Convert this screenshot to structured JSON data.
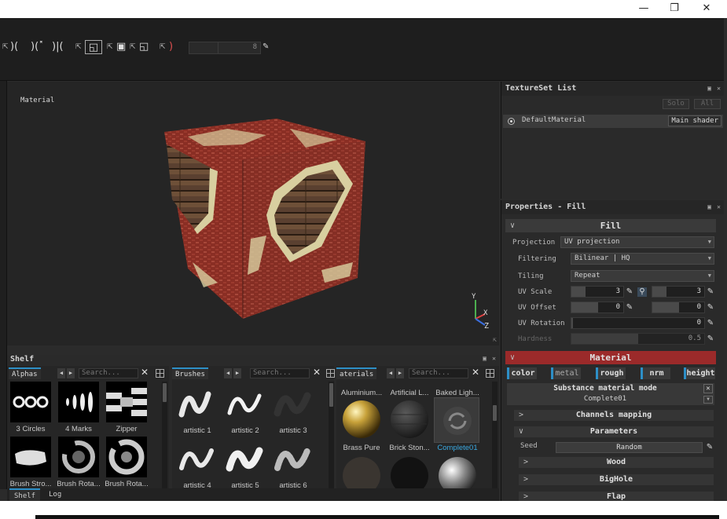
{
  "toolbar": {
    "field_value": "8"
  },
  "viewport": {
    "label": "Material",
    "axes": {
      "y": "Y",
      "x": "X",
      "z": "Z"
    }
  },
  "texture_set_list": {
    "title": "TextureSet List",
    "solo_label": "Solo",
    "all_label": "All",
    "material_name": "DefaultMaterial",
    "shader_label": "Main shader"
  },
  "properties": {
    "title": "Properties - Fill",
    "fill_section": "Fill",
    "projection_label": "Projection",
    "projection_value": "UV projection",
    "filtering_label": "Filtering",
    "filtering_value": "Bilinear | HQ",
    "tiling_label": "Tiling",
    "tiling_value": "Repeat",
    "uv_scale_label": "UV Scale",
    "uv_scale": [
      "3",
      "3"
    ],
    "uv_offset_label": "UV Offset",
    "uv_offset": [
      "0",
      "0"
    ],
    "uv_rotation_label": "UV Rotation",
    "uv_rotation": "0",
    "hardness_label": "Hardness",
    "hardness": "0.5",
    "material_section": "Material",
    "channels": [
      "color",
      "metal",
      "rough",
      "nrm",
      "height"
    ],
    "substance_mode_label": "Substance material mode",
    "substance_mode_value": "Complete01",
    "channels_mapping": "Channels mapping",
    "parameters": "Parameters",
    "seed_label": "Seed",
    "seed_button": "Random",
    "groups": [
      "Wood",
      "BigHole",
      "Flap"
    ]
  },
  "shelf": {
    "title": "Shelf",
    "alphas": {
      "tab": "Alphas",
      "search_placeholder": "Search...",
      "items": [
        "3 Circles",
        "4 Marks",
        "Zipper",
        "Brush Stro...",
        "Brush Rota...",
        "Brush Rota..."
      ]
    },
    "brushes": {
      "tab": "Brushes",
      "search_placeholder": "Search...",
      "items": [
        "artistic 1",
        "artistic 2",
        "artistic 3",
        "artistic 4",
        "artistic 5",
        "artistic 6"
      ]
    },
    "materials": {
      "tab": "aterials",
      "search_placeholder": "Search...",
      "items": [
        "Aluminium...",
        "Artificial L...",
        "Baked Ligh...",
        "Brass Pure",
        "Brick Ston...",
        "Complete01"
      ],
      "selected": "Complete01"
    }
  },
  "bottom_tabs": [
    "Shelf",
    "Log"
  ],
  "colors": {
    "accent": "#2d8fc7",
    "material_red": "#9b2a2a",
    "panel_bg": "#2a2a2a"
  }
}
